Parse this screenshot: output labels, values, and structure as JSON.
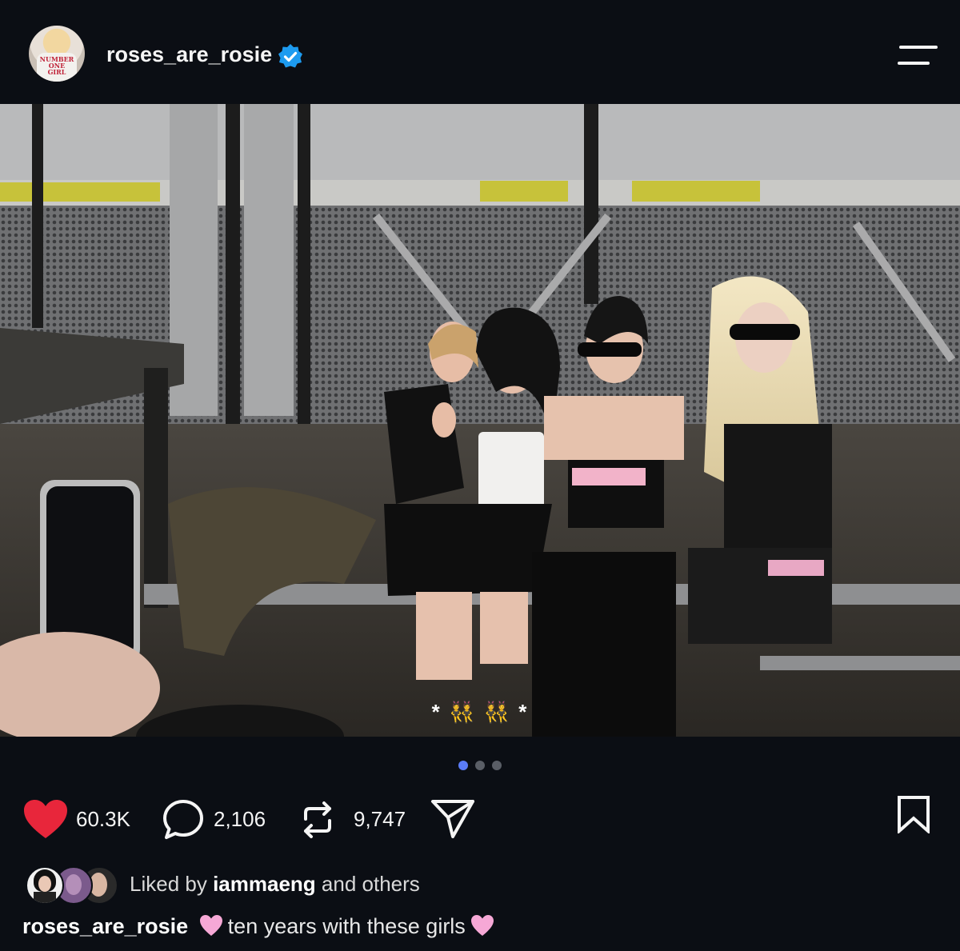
{
  "header": {
    "username": "roses_are_rosie",
    "avatar_shirt_text": [
      "NUMBER",
      "ONE",
      "GIRL"
    ],
    "verified_icon": "verified-badge-icon",
    "menu_icon": "hamburger-menu-icon"
  },
  "post": {
    "image_caption": "* 👯 👯 *",
    "carousel": {
      "total": 3,
      "active": 0
    }
  },
  "actions": {
    "likes": "60.3K",
    "comments": "2,106",
    "reposts": "9,747",
    "like_icon": "heart-filled-icon",
    "comment_icon": "comment-bubble-icon",
    "repost_icon": "repost-arrows-icon",
    "share_icon": "send-paper-plane-icon",
    "save_icon": "bookmark-icon"
  },
  "liked_by": {
    "prefix": "Liked by ",
    "user": "iammaeng",
    "suffix": " and others"
  },
  "caption": {
    "username": "roses_are_rosie",
    "text": "ten years with these girls"
  },
  "colors": {
    "background": "#0b0e14",
    "like_red": "#e8263b",
    "verified_blue": "#1d9bf0",
    "active_dot": "#5b7cf7",
    "pink_heart": "#f6a8d6"
  }
}
